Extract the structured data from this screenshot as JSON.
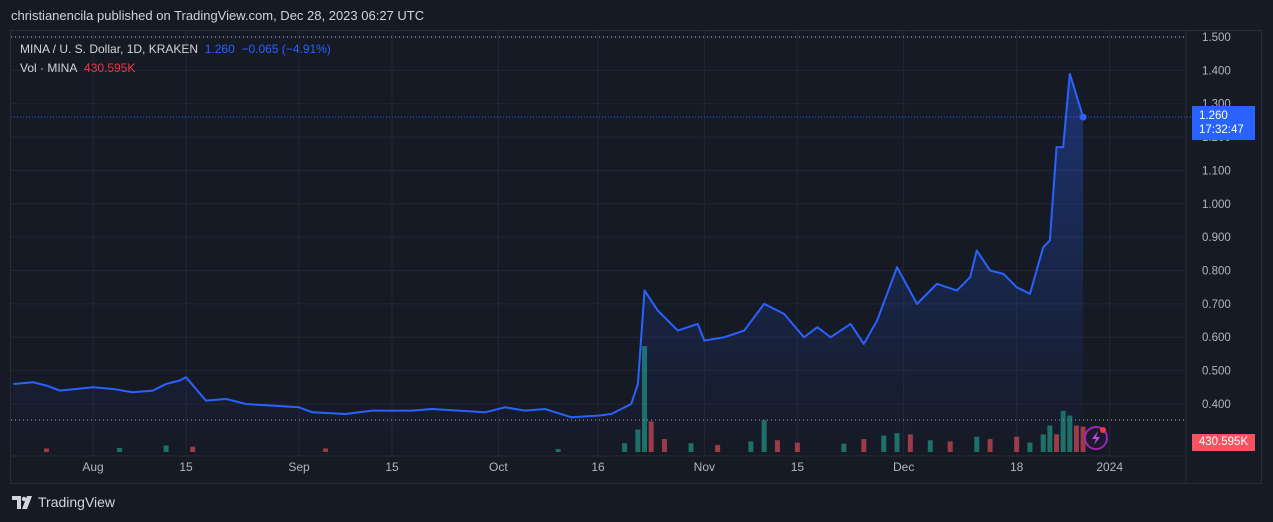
{
  "header": "christianencila published on TradingView.com, Dec 28, 2023 06:27 UTC",
  "legend": {
    "symbol": "MINA / U. S. Dollar, 1D, KRAKEN",
    "price": "1.260",
    "change": "−0.065 (−4.91%)",
    "vol_label": "Vol · MINA",
    "vol_value": "430.595K"
  },
  "price_tag": {
    "price": "1.260",
    "countdown": "17:32:47"
  },
  "vol_tag": "430.595K",
  "footer": {
    "brand": "TradingView"
  },
  "colors": {
    "line": "#2962ff",
    "up": "#22ab94",
    "down": "#f7525f"
  },
  "chart_data": {
    "type": "line",
    "title": "MINA / U. S. Dollar, 1D, KRAKEN",
    "ylim": [
      0.3,
      1.5
    ],
    "y_ticks": [
      "1.500",
      "1.400",
      "1.300",
      "1.200",
      "1.100",
      "1.000",
      "0.900",
      "0.800",
      "0.700",
      "0.600",
      "0.500",
      "0.400"
    ],
    "x_ticks": [
      {
        "label": "Aug",
        "date": "2023-08-01"
      },
      {
        "label": "15",
        "date": "2023-08-15"
      },
      {
        "label": "Sep",
        "date": "2023-09-01"
      },
      {
        "label": "15",
        "date": "2023-09-15"
      },
      {
        "label": "Oct",
        "date": "2023-10-01"
      },
      {
        "label": "16",
        "date": "2023-10-16"
      },
      {
        "label": "Nov",
        "date": "2023-11-01"
      },
      {
        "label": "15",
        "date": "2023-11-15"
      },
      {
        "label": "Dec",
        "date": "2023-12-01"
      },
      {
        "label": "18",
        "date": "2023-12-18"
      },
      {
        "label": "2024",
        "date": "2024-01-01"
      }
    ],
    "price": [
      [
        "2023-07-20",
        0.46
      ],
      [
        "2023-07-23",
        0.465
      ],
      [
        "2023-07-25",
        0.455
      ],
      [
        "2023-07-27",
        0.44
      ],
      [
        "2023-08-01",
        0.45
      ],
      [
        "2023-08-04",
        0.445
      ],
      [
        "2023-08-07",
        0.435
      ],
      [
        "2023-08-10",
        0.44
      ],
      [
        "2023-08-12",
        0.46
      ],
      [
        "2023-08-14",
        0.47
      ],
      [
        "2023-08-15",
        0.48
      ],
      [
        "2023-08-18",
        0.41
      ],
      [
        "2023-08-21",
        0.415
      ],
      [
        "2023-08-24",
        0.4
      ],
      [
        "2023-08-28",
        0.395
      ],
      [
        "2023-09-01",
        0.39
      ],
      [
        "2023-09-03",
        0.375
      ],
      [
        "2023-09-08",
        0.37
      ],
      [
        "2023-09-12",
        0.38
      ],
      [
        "2023-09-15",
        0.38
      ],
      [
        "2023-09-18",
        0.38
      ],
      [
        "2023-09-21",
        0.385
      ],
      [
        "2023-09-25",
        0.38
      ],
      [
        "2023-09-29",
        0.375
      ],
      [
        "2023-10-02",
        0.39
      ],
      [
        "2023-10-05",
        0.38
      ],
      [
        "2023-10-08",
        0.385
      ],
      [
        "2023-10-12",
        0.36
      ],
      [
        "2023-10-16",
        0.365
      ],
      [
        "2023-10-18",
        0.37
      ],
      [
        "2023-10-21",
        0.4
      ],
      [
        "2023-10-22",
        0.46
      ],
      [
        "2023-10-23",
        0.74
      ],
      [
        "2023-10-25",
        0.68
      ],
      [
        "2023-10-28",
        0.62
      ],
      [
        "2023-10-31",
        0.64
      ],
      [
        "2023-11-01",
        0.59
      ],
      [
        "2023-11-04",
        0.6
      ],
      [
        "2023-11-07",
        0.62
      ],
      [
        "2023-11-10",
        0.7
      ],
      [
        "2023-11-13",
        0.67
      ],
      [
        "2023-11-16",
        0.6
      ],
      [
        "2023-11-18",
        0.63
      ],
      [
        "2023-11-20",
        0.6
      ],
      [
        "2023-11-23",
        0.64
      ],
      [
        "2023-11-25",
        0.58
      ],
      [
        "2023-11-27",
        0.65
      ],
      [
        "2023-11-30",
        0.81
      ],
      [
        "2023-12-03",
        0.7
      ],
      [
        "2023-12-06",
        0.76
      ],
      [
        "2023-12-09",
        0.74
      ],
      [
        "2023-12-11",
        0.78
      ],
      [
        "2023-12-12",
        0.86
      ],
      [
        "2023-12-14",
        0.8
      ],
      [
        "2023-12-16",
        0.79
      ],
      [
        "2023-12-18",
        0.75
      ],
      [
        "2023-12-20",
        0.73
      ],
      [
        "2023-12-22",
        0.87
      ],
      [
        "2023-12-23",
        0.89
      ],
      [
        "2023-12-24",
        1.17
      ],
      [
        "2023-12-25",
        1.17
      ],
      [
        "2023-12-26",
        1.39
      ],
      [
        "2023-12-28",
        1.26
      ]
    ],
    "volume_k": [
      [
        "2023-07-25",
        60,
        "down"
      ],
      [
        "2023-08-05",
        70,
        "up"
      ],
      [
        "2023-08-12",
        110,
        "up"
      ],
      [
        "2023-08-16",
        90,
        "down"
      ],
      [
        "2023-09-05",
        60,
        "down"
      ],
      [
        "2023-10-10",
        50,
        "up"
      ],
      [
        "2023-10-20",
        150,
        "up"
      ],
      [
        "2023-10-22",
        380,
        "up"
      ],
      [
        "2023-10-23",
        1800,
        "up"
      ],
      [
        "2023-10-24",
        520,
        "down"
      ],
      [
        "2023-10-26",
        220,
        "down"
      ],
      [
        "2023-10-30",
        150,
        "up"
      ],
      [
        "2023-11-03",
        120,
        "down"
      ],
      [
        "2023-11-08",
        180,
        "up"
      ],
      [
        "2023-11-10",
        540,
        "up"
      ],
      [
        "2023-11-12",
        200,
        "down"
      ],
      [
        "2023-11-15",
        160,
        "down"
      ],
      [
        "2023-11-22",
        140,
        "up"
      ],
      [
        "2023-11-25",
        220,
        "down"
      ],
      [
        "2023-11-28",
        280,
        "up"
      ],
      [
        "2023-11-30",
        320,
        "up"
      ],
      [
        "2023-12-02",
        300,
        "down"
      ],
      [
        "2023-12-05",
        200,
        "up"
      ],
      [
        "2023-12-08",
        180,
        "down"
      ],
      [
        "2023-12-12",
        260,
        "up"
      ],
      [
        "2023-12-14",
        220,
        "down"
      ],
      [
        "2023-12-18",
        260,
        "down"
      ],
      [
        "2023-12-20",
        160,
        "up"
      ],
      [
        "2023-12-22",
        300,
        "up"
      ],
      [
        "2023-12-23",
        450,
        "up"
      ],
      [
        "2023-12-24",
        300,
        "down"
      ],
      [
        "2023-12-25",
        700,
        "up"
      ],
      [
        "2023-12-26",
        620,
        "up"
      ],
      [
        "2023-12-27",
        450,
        "down"
      ],
      [
        "2023-12-28",
        430.595,
        "down"
      ]
    ]
  }
}
